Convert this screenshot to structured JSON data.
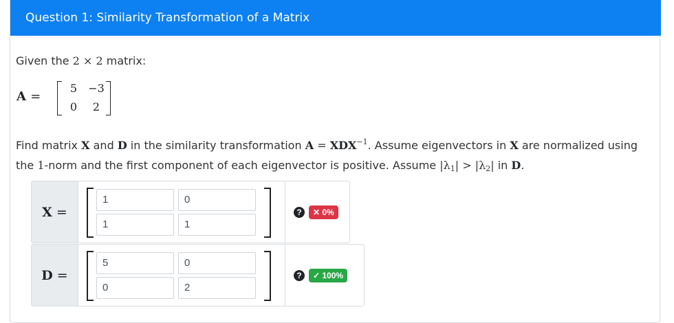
{
  "header": {
    "title": "Question 1: Similarity Transformation of a Matrix"
  },
  "question": {
    "given_prefix": "Given the ",
    "given_dims": "2 × 2",
    "given_suffix": " matrix:",
    "matrix_name": "A",
    "matrix_a": [
      [
        "5",
        "−3"
      ],
      [
        "0",
        "2"
      ]
    ],
    "find_1": "Find matrix ",
    "find_X": "X",
    "find_and": " and ",
    "find_D": "D",
    "find_2": " in the similarity transformation ",
    "eq_lhs": "A",
    "eq_sign": " = ",
    "eq_rhs": "XDX",
    "eq_sup": "−1",
    "find_3": ". Assume eigenvectors in ",
    "find_X2": "X",
    "find_4": " are normalized using the ",
    "norm_num": "1",
    "find_5": "-norm and the first component of each eigenvector is positive. Assume ",
    "lam1": "|λ",
    "lam1_sub": "1",
    "lam1_end": "|",
    "gt": " > ",
    "lam2": "|λ",
    "lam2_sub": "2",
    "lam2_end": "|",
    "find_6": " in ",
    "find_D2": "D",
    "find_7": "."
  },
  "answers": {
    "x": {
      "label": "X",
      "eq": "=",
      "values": [
        [
          "1",
          "0"
        ],
        [
          "1",
          "1"
        ]
      ],
      "help": "?",
      "score": "✕ 0%",
      "score_color": "#dc3545"
    },
    "d": {
      "label": "D",
      "eq": "=",
      "values": [
        [
          "5",
          "0"
        ],
        [
          "0",
          "2"
        ]
      ],
      "help": "?",
      "score": "✓ 100%",
      "score_color": "#28a745"
    }
  },
  "icons": {
    "help": "help-circle-icon",
    "wrong": "x-mark-icon",
    "correct": "check-mark-icon"
  }
}
